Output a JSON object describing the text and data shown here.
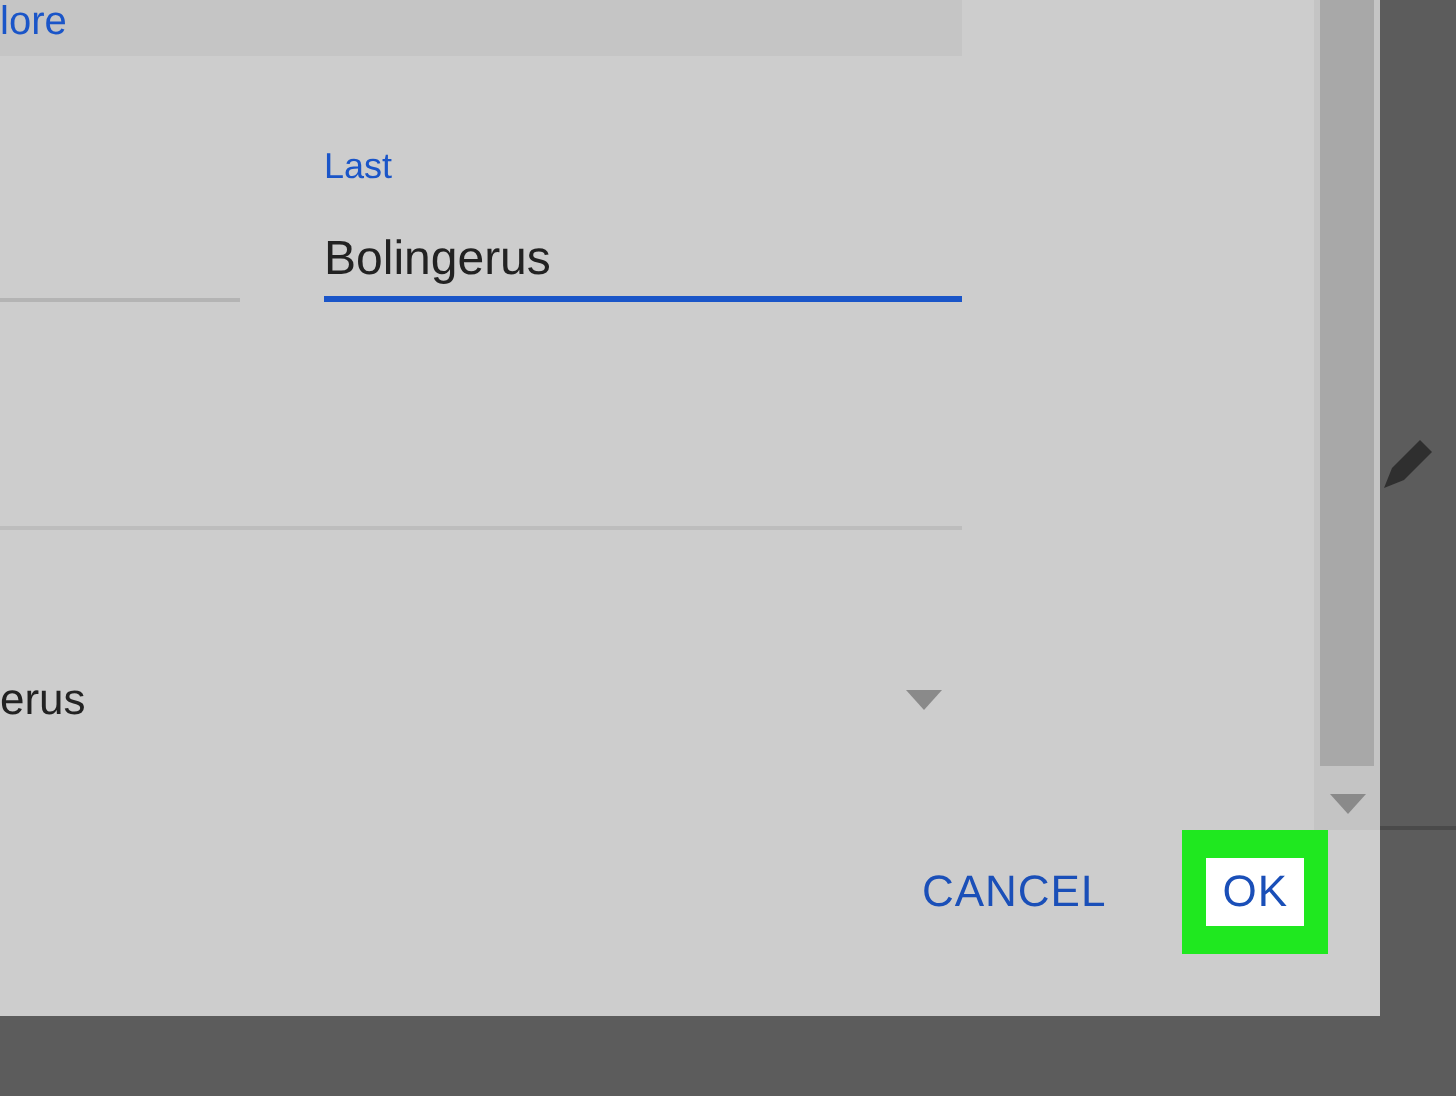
{
  "header_panel": {
    "link": "lore"
  },
  "last_name_field": {
    "label": "Last",
    "value": "Bolingerus",
    "focused": true
  },
  "dropdown": {
    "value": "erus"
  },
  "buttons": [
    {
      "label": "CANCEL",
      "highlighted": false
    },
    {
      "label": "OK",
      "highlighted": true
    }
  ]
}
